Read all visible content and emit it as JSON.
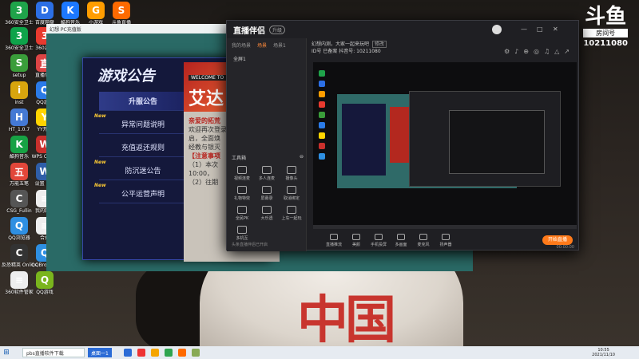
{
  "desktop": {
    "icons": [
      {
        "label": "360安全卫士",
        "color": "#1fa34a",
        "glyph": "3"
      },
      {
        "label": "百度网盘",
        "color": "#2c6fe5",
        "glyph": "D"
      },
      {
        "label": "酷狗音乐",
        "color": "#1c78ff",
        "glyph": "K"
      },
      {
        "label": "小游戏",
        "color": "#ff9d00",
        "glyph": "G"
      },
      {
        "label": "斗鱼直播",
        "color": "#ff6a00",
        "glyph": "S"
      },
      {
        "label": "360安全卫士",
        "color": "#0ea34a",
        "glyph": "3"
      },
      {
        "label": "360游戏",
        "color": "#e83a2f",
        "glyph": "3"
      },
      {
        "label": "setup",
        "color": "#3a9d3a",
        "glyph": "S"
      },
      {
        "label": "直播伴侣",
        "color": "#d44",
        "glyph": "直"
      },
      {
        "label": "inst",
        "color": "#d8a50e",
        "glyph": "i"
      },
      {
        "label": "QQ游戏",
        "color": "#2b7be8",
        "glyph": "Q"
      },
      {
        "label": "HT_1.0.7",
        "color": "#4479d4",
        "glyph": "H"
      },
      {
        "label": "YY开播",
        "color": "#ffd400",
        "glyph": "Y"
      },
      {
        "label": "酷狗音乐",
        "color": "#17a244",
        "glyph": "K"
      },
      {
        "label": "WPS Office",
        "color": "#c9302c",
        "glyph": "W"
      },
      {
        "label": "万能五笔",
        "color": "#e2473a",
        "glyph": "五"
      },
      {
        "label": "设置 RTF",
        "color": "#2f5ea8",
        "glyph": "W"
      },
      {
        "label": "CSG_Fullin",
        "color": "#555",
        "glyph": "C"
      },
      {
        "label": "我的网课",
        "color": "#eee",
        "glyph": "≡"
      },
      {
        "label": "QQ浏览器",
        "color": "#2e8fe2",
        "glyph": "Q"
      },
      {
        "label": "合并",
        "color": "#eee",
        "glyph": "≡"
      },
      {
        "label": "反恐精英 Online",
        "color": "#333",
        "glyph": "C"
      },
      {
        "label": "QQBrowser",
        "color": "#2e8fe2",
        "glyph": "Q"
      },
      {
        "label": "360软件管家",
        "color": "#eee",
        "glyph": "≡"
      },
      {
        "label": "QQ游戏",
        "color": "#7ab51d",
        "glyph": "Q"
      }
    ]
  },
  "watermark": {
    "logo": "斗鱼",
    "sub": "房间号",
    "room": "10211080"
  },
  "game_window": {
    "title": "幻想 PC充值版",
    "panel_title": "游戏公告",
    "items": [
      {
        "label": "升服公告",
        "new": false,
        "active": true
      },
      {
        "label": "异常问题说明",
        "new": true,
        "active": false
      },
      {
        "label": "充值返还规则",
        "new": false,
        "active": false
      },
      {
        "label": "防沉迷公告",
        "new": true,
        "active": false
      },
      {
        "label": "公平运营声明",
        "new": true,
        "active": false
      }
    ],
    "new_label": "New",
    "banner_small": "WELCOME TO",
    "banner_big": "艾达",
    "content_lines": [
      {
        "text": "亲爱的拓荒",
        "red": true
      },
      {
        "text": "欢迎再次登录",
        "red": false
      },
      {
        "text": "启，全面焕",
        "red": false
      },
      {
        "text": "经教与银灭",
        "red": false
      },
      {
        "text": "【注意事项",
        "red": true
      },
      {
        "text": "（1）本次",
        "red": false
      },
      {
        "text": "10:00，",
        "red": false
      },
      {
        "text": "（2）往期",
        "red": false
      }
    ]
  },
  "app_window": {
    "logo": "直播伴侣",
    "version": "升级",
    "controls": [
      "—",
      "□",
      "✕"
    ],
    "left_tabs": [
      "我的场景",
      "场景",
      "场景1"
    ],
    "scene": "全屏1",
    "toolbox_label": "工具箱",
    "tools": [
      "视频连麦",
      "多人连麦",
      "摄像头",
      "礼物特效",
      "屏幕录",
      "取消绑定",
      "全民PK",
      "大乐透",
      "上车一起玩",
      "多机互"
    ],
    "left_footer": "头条直播伴侣已开启",
    "main_top_line1": "幻想内测，大家一起来玩吧",
    "main_top_tag": "修改",
    "main_top_line2": "ID号  已备案  抖音号: 10211080",
    "top_icons": [
      "⚙",
      "♪",
      "⊕",
      "◎",
      "♫",
      "△",
      "↗"
    ],
    "bottom_buttons": [
      "直播推流",
      "美颜",
      "手机投屏",
      "多画面",
      "麦克风",
      "扬声器"
    ],
    "start_label": "开始直播",
    "status_time": "00:00:00"
  },
  "taskbar": {
    "start": "⊞",
    "search": "pbs直播软件下载",
    "active_task": "桌面一1",
    "apps": [
      "#2b6bd6",
      "#e33",
      "#f5a500",
      "#2ea44f",
      "#ff6a00",
      "#8a5"
    ],
    "time": "10:55",
    "date": "2021/11/10"
  }
}
